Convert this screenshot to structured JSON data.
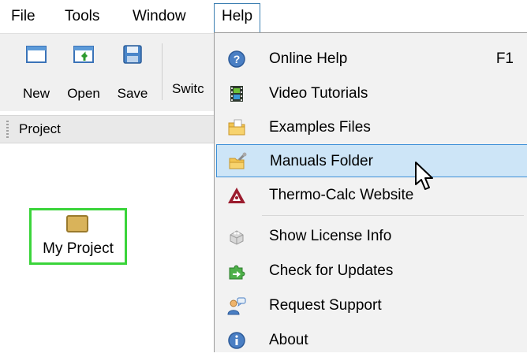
{
  "menubar": {
    "items": [
      {
        "label": "File"
      },
      {
        "label": "Tools"
      },
      {
        "label": "Window"
      },
      {
        "label": "Help"
      }
    ]
  },
  "toolbar": {
    "new_label": "New",
    "open_label": "Open",
    "save_label": "Save",
    "switch_label": "Switc"
  },
  "project_panel": {
    "title": "Project",
    "node_label": "My Project",
    "node_border_color": "#3ad43a"
  },
  "help_menu": {
    "items": [
      {
        "label": "Online Help",
        "shortcut": "F1",
        "icon": "help-circle-icon"
      },
      {
        "label": "Video Tutorials",
        "icon": "film-icon"
      },
      {
        "label": "Examples Files",
        "icon": "folder-icon"
      },
      {
        "label": "Manuals Folder",
        "icon": "folder-wrench-icon",
        "highlighted": true
      },
      {
        "label": "Thermo-Calc Website",
        "icon": "thermo-calc-logo-icon"
      },
      {
        "label": "Show License Info",
        "icon": "license-icon"
      },
      {
        "label": "Check for Updates",
        "icon": "update-puzzle-icon"
      },
      {
        "label": "Request Support",
        "icon": "support-person-icon"
      },
      {
        "label": "About",
        "icon": "info-icon"
      }
    ],
    "highlight_color": "#cde5f7",
    "highlight_border": "#3c8fd8"
  }
}
